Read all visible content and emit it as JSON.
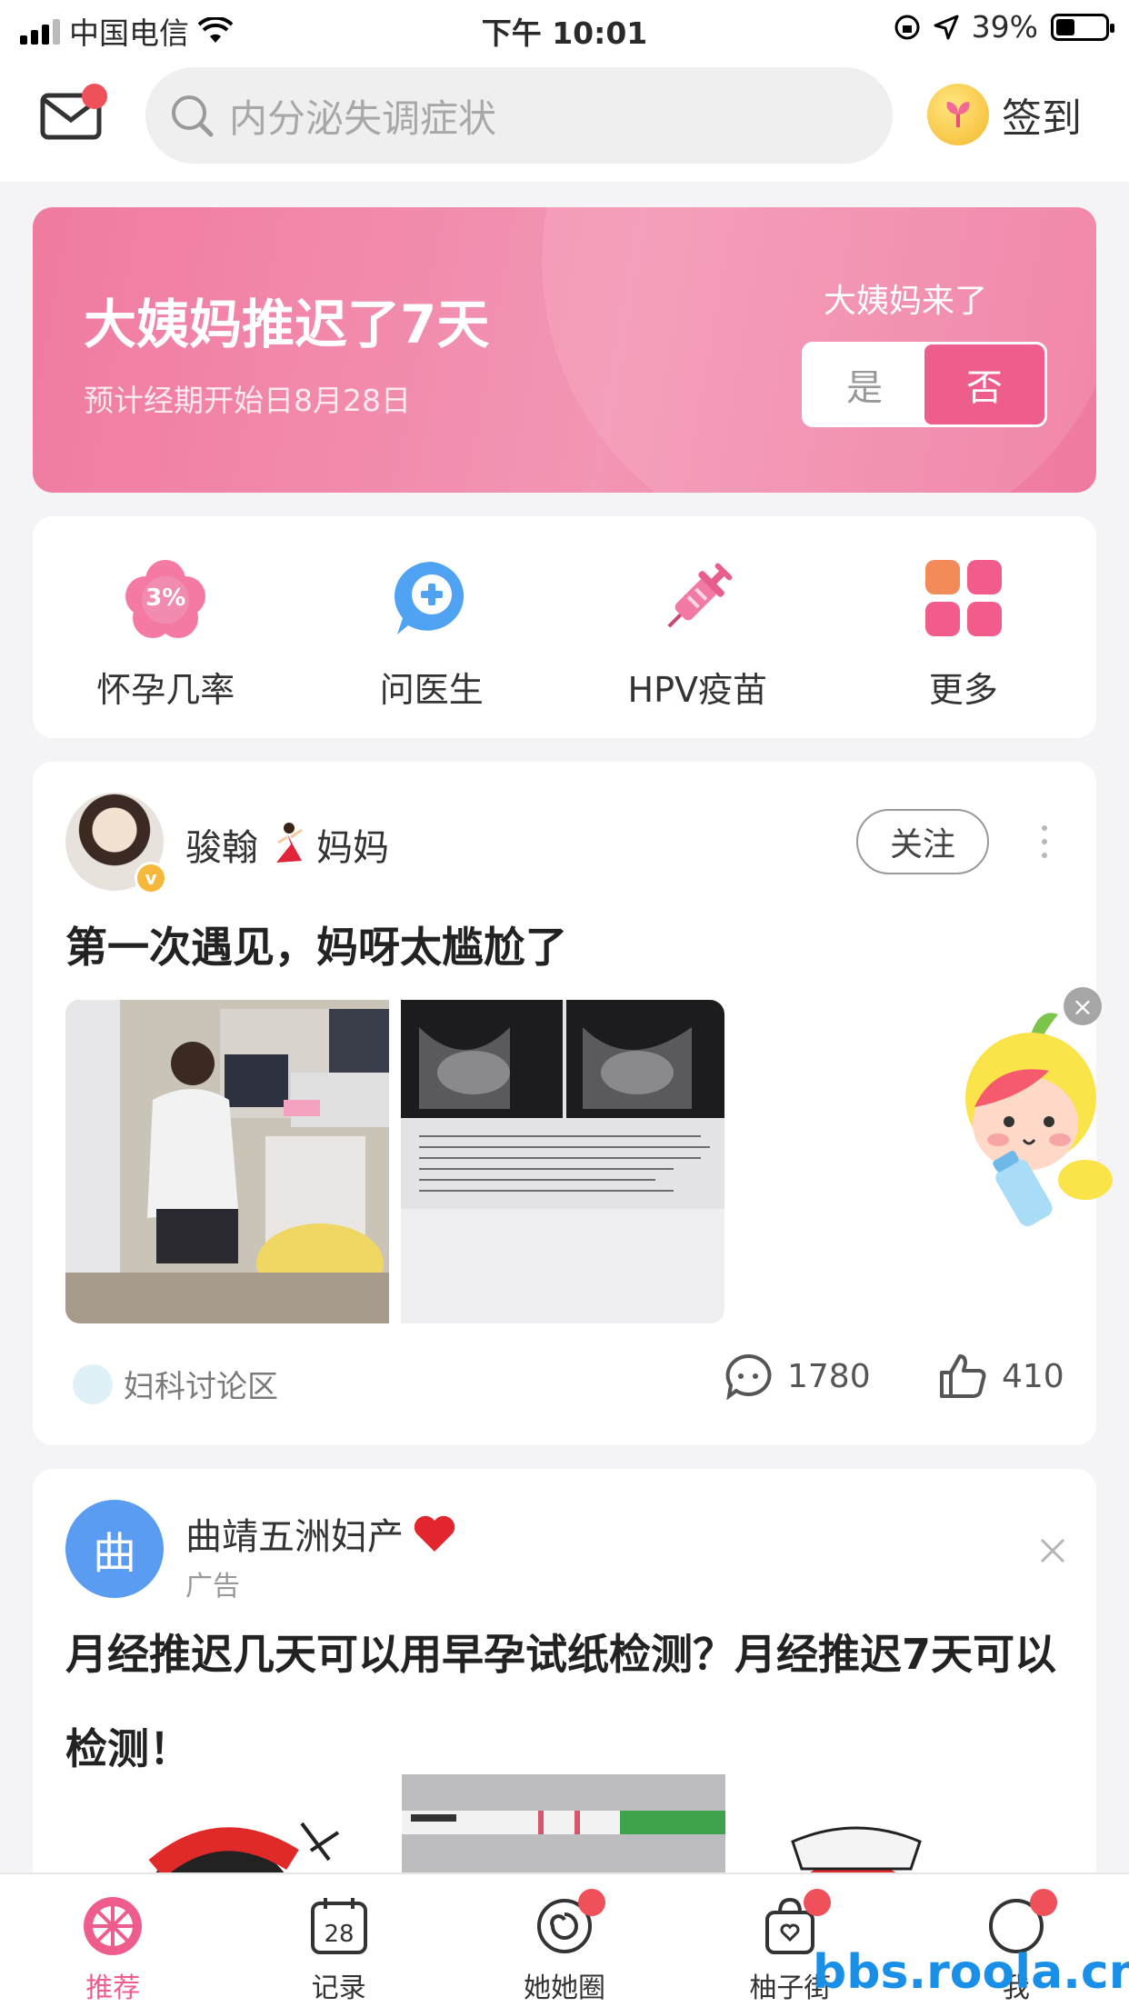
{
  "status_bar": {
    "carrier": "中国电信",
    "time": "下午 10:01",
    "battery": "39%"
  },
  "header": {
    "search_placeholder": "内分泌失调症状",
    "signin_label": "签到"
  },
  "banner": {
    "title": "大姨妈推迟了7天",
    "subtitle": "预计经期开始日8月28日",
    "question": "大姨妈来了",
    "yes": "是",
    "no": "否",
    "selected": "否"
  },
  "quick_actions": [
    {
      "label": "怀孕几率",
      "icon": "pregnancy-chance-icon",
      "badge": "3%"
    },
    {
      "label": "问医生",
      "icon": "ask-doctor-icon"
    },
    {
      "label": "HPV疫苗",
      "icon": "vaccine-icon"
    },
    {
      "label": "更多",
      "icon": "more-grid-icon"
    }
  ],
  "post": {
    "author": "骏翰",
    "author_suffix": "妈妈",
    "follow_label": "关注",
    "title": "第一次遇见，妈呀太尴尬了",
    "forum": "妇科讨论区",
    "comments": "1780",
    "likes": "410"
  },
  "ad": {
    "name": "曲靖五洲妇产",
    "avatar_char": "曲",
    "tag": "广告",
    "title": "月经推迟几天可以用早孕试纸检测？月经推迟7天可以检测！"
  },
  "tabs": [
    {
      "label": "推荐",
      "active": true,
      "icon": "grapefruit-icon"
    },
    {
      "label": "记录",
      "icon": "calendar-icon",
      "day": "28"
    },
    {
      "label": "她她圈",
      "icon": "circle-swirl-icon",
      "badge": true
    },
    {
      "label": "柚子街",
      "icon": "shopping-bag-icon",
      "badge": true
    },
    {
      "label": "我",
      "icon": "profile-icon",
      "badge": true
    }
  ],
  "watermark": "bbs.roola.cn",
  "colors": {
    "accent": "#ef5d8c",
    "banner": "#f395b4",
    "badge": "#f0505a"
  }
}
